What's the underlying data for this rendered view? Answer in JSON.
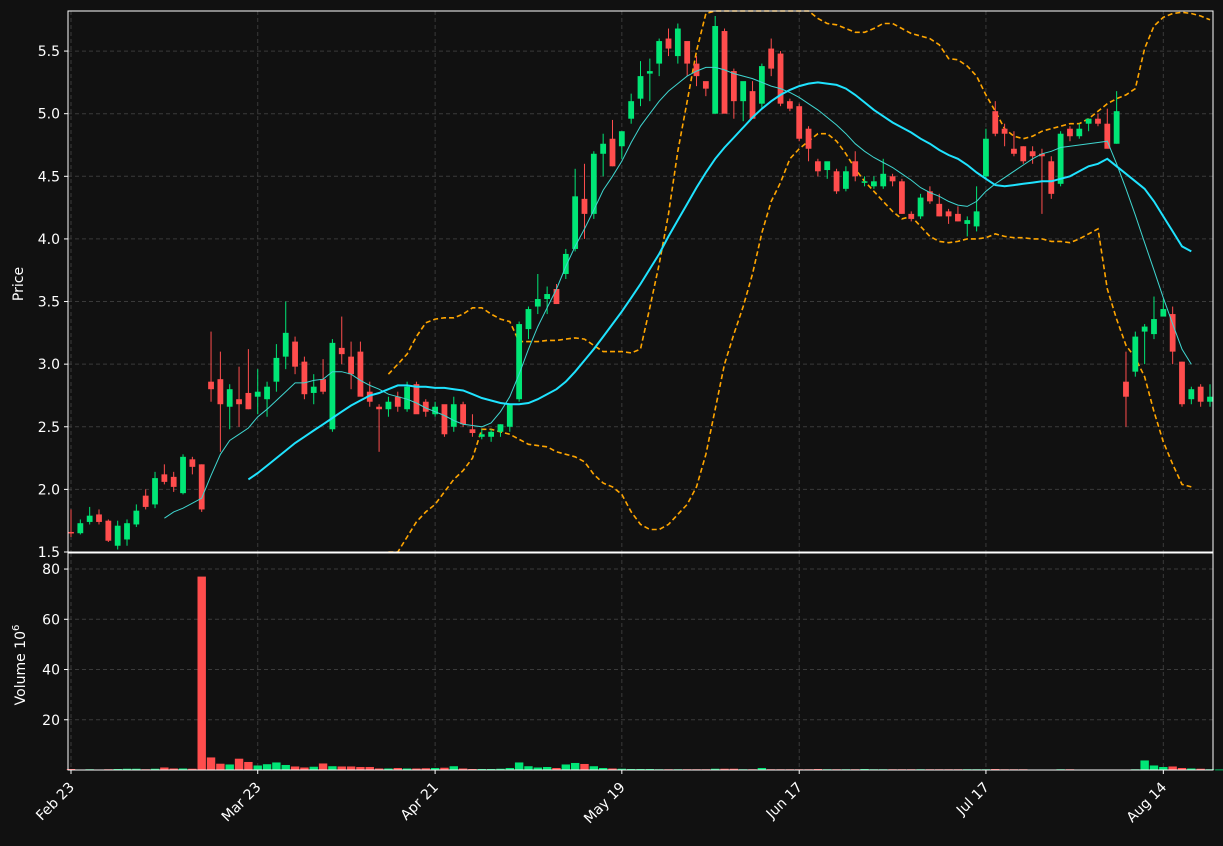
{
  "chart_data": [
    {
      "type": "candlestick",
      "panel": "price",
      "ylabel": "Price",
      "ylim": [
        1.5,
        5.82
      ],
      "y_ticks": [
        "1.5",
        "2.0",
        "2.5",
        "3.0",
        "3.5",
        "4.0",
        "4.5",
        "5.0",
        "5.5"
      ],
      "grid": true,
      "colors": {
        "up": "#00e676",
        "down": "#ff4d4d",
        "ma_fast": "#3fd6d0",
        "ma_slow": "#1fe3ff",
        "bands": "#ffa500",
        "background": "#111111"
      },
      "candles": [
        [
          1.66,
          1.84,
          1.62,
          1.65
        ],
        [
          1.65,
          1.76,
          1.64,
          1.73
        ],
        [
          1.74,
          1.86,
          1.72,
          1.79
        ],
        [
          1.8,
          1.84,
          1.72,
          1.74
        ],
        [
          1.75,
          1.76,
          1.58,
          1.59
        ],
        [
          1.55,
          1.75,
          1.52,
          1.71
        ],
        [
          1.6,
          1.76,
          1.55,
          1.73
        ],
        [
          1.72,
          1.88,
          1.7,
          1.83
        ],
        [
          1.95,
          2.0,
          1.84,
          1.86
        ],
        [
          1.88,
          2.14,
          1.85,
          2.09
        ],
        [
          2.12,
          2.2,
          2.04,
          2.06
        ],
        [
          2.1,
          2.14,
          1.98,
          2.02
        ],
        [
          1.97,
          2.28,
          1.96,
          2.26
        ],
        [
          2.24,
          2.26,
          2.12,
          2.18
        ],
        [
          2.2,
          2.2,
          1.82,
          1.84
        ],
        [
          2.86,
          3.26,
          2.7,
          2.8
        ],
        [
          2.88,
          3.1,
          2.3,
          2.68
        ],
        [
          2.66,
          2.84,
          2.48,
          2.8
        ],
        [
          2.72,
          2.98,
          2.5,
          2.68
        ],
        [
          2.77,
          3.12,
          2.64,
          2.64
        ],
        [
          2.74,
          2.96,
          2.6,
          2.78
        ],
        [
          2.72,
          2.86,
          2.58,
          2.82
        ],
        [
          2.86,
          3.16,
          2.78,
          3.05
        ],
        [
          3.06,
          3.5,
          2.96,
          3.25
        ],
        [
          3.18,
          3.22,
          2.92,
          2.98
        ],
        [
          3.02,
          3.06,
          2.72,
          2.76
        ],
        [
          2.77,
          2.92,
          2.68,
          2.82
        ],
        [
          2.88,
          3.04,
          2.76,
          2.78
        ],
        [
          2.48,
          3.2,
          2.46,
          3.17
        ],
        [
          3.13,
          3.38,
          3.0,
          3.08
        ],
        [
          3.06,
          3.18,
          2.8,
          2.92
        ],
        [
          3.1,
          3.18,
          2.76,
          2.74
        ],
        [
          2.78,
          2.86,
          2.66,
          2.7
        ],
        [
          2.66,
          2.68,
          2.3,
          2.64
        ],
        [
          2.64,
          2.74,
          2.58,
          2.7
        ],
        [
          2.74,
          2.78,
          2.62,
          2.66
        ],
        [
          2.64,
          2.86,
          2.62,
          2.82
        ],
        [
          2.84,
          2.86,
          2.66,
          2.6
        ],
        [
          2.7,
          2.72,
          2.58,
          2.62
        ],
        [
          2.6,
          2.7,
          2.58,
          2.66
        ],
        [
          2.68,
          2.64,
          2.42,
          2.44
        ],
        [
          2.5,
          2.74,
          2.46,
          2.68
        ],
        [
          2.68,
          2.7,
          2.5,
          2.52
        ],
        [
          2.48,
          2.6,
          2.42,
          2.45
        ],
        [
          2.42,
          2.48,
          2.4,
          2.44
        ],
        [
          2.42,
          2.48,
          2.38,
          2.46
        ],
        [
          2.46,
          2.52,
          2.42,
          2.52
        ],
        [
          2.5,
          2.68,
          2.46,
          2.68
        ],
        [
          2.72,
          3.34,
          2.7,
          3.32
        ],
        [
          3.28,
          3.46,
          3.2,
          3.44
        ],
        [
          3.46,
          3.72,
          3.4,
          3.52
        ],
        [
          3.52,
          3.62,
          3.4,
          3.56
        ],
        [
          3.6,
          3.64,
          3.48,
          3.48
        ],
        [
          3.72,
          3.92,
          3.68,
          3.88
        ],
        [
          3.92,
          4.56,
          3.9,
          4.34
        ],
        [
          4.32,
          4.6,
          4.0,
          4.2
        ],
        [
          4.2,
          4.7,
          4.16,
          4.68
        ],
        [
          4.68,
          4.84,
          4.5,
          4.76
        ],
        [
          4.8,
          4.95,
          4.58,
          4.58
        ],
        [
          4.74,
          4.86,
          4.64,
          4.86
        ],
        [
          4.96,
          5.16,
          4.92,
          5.1
        ],
        [
          5.12,
          5.42,
          5.06,
          5.3
        ],
        [
          5.32,
          5.44,
          5.1,
          5.34
        ],
        [
          5.4,
          5.6,
          5.3,
          5.58
        ],
        [
          5.6,
          5.68,
          5.46,
          5.52
        ],
        [
          5.46,
          5.72,
          5.4,
          5.68
        ],
        [
          5.58,
          5.52,
          5.3,
          5.4
        ],
        [
          5.4,
          5.46,
          5.22,
          5.3
        ],
        [
          5.26,
          5.24,
          5.14,
          5.2
        ],
        [
          5.0,
          5.78,
          5.0,
          5.7
        ],
        [
          5.66,
          5.68,
          5.02,
          5.0
        ],
        [
          5.34,
          5.36,
          4.96,
          5.1
        ],
        [
          5.1,
          5.2,
          4.94,
          5.26
        ],
        [
          5.18,
          5.26,
          4.96,
          4.96
        ],
        [
          5.08,
          5.4,
          5.04,
          5.38
        ],
        [
          5.52,
          5.6,
          5.3,
          5.36
        ],
        [
          5.48,
          5.5,
          5.06,
          5.08
        ],
        [
          5.1,
          5.12,
          5.02,
          5.04
        ],
        [
          5.06,
          5.08,
          4.78,
          4.8
        ],
        [
          4.88,
          4.9,
          4.62,
          4.72
        ],
        [
          4.62,
          4.64,
          4.5,
          4.54
        ],
        [
          4.55,
          4.6,
          4.48,
          4.62
        ],
        [
          4.54,
          4.56,
          4.36,
          4.38
        ],
        [
          4.4,
          4.58,
          4.38,
          4.54
        ],
        [
          4.62,
          4.7,
          4.46,
          4.5
        ],
        [
          4.46,
          4.5,
          4.42,
          4.46
        ],
        [
          4.42,
          4.5,
          4.4,
          4.46
        ],
        [
          4.42,
          4.64,
          4.4,
          4.52
        ],
        [
          4.5,
          4.52,
          4.42,
          4.46
        ],
        [
          4.46,
          4.48,
          4.2,
          4.2
        ],
        [
          4.2,
          4.22,
          4.14,
          4.16
        ],
        [
          4.18,
          4.36,
          4.16,
          4.33
        ],
        [
          4.38,
          4.42,
          4.28,
          4.3
        ],
        [
          4.28,
          4.36,
          4.18,
          4.18
        ],
        [
          4.22,
          4.24,
          4.12,
          4.18
        ],
        [
          4.2,
          4.26,
          4.14,
          4.14
        ],
        [
          4.12,
          4.18,
          4.02,
          4.15
        ],
        [
          4.1,
          4.42,
          4.06,
          4.22
        ],
        [
          4.5,
          4.88,
          4.48,
          4.8
        ],
        [
          5.02,
          5.1,
          4.82,
          4.84
        ],
        [
          4.88,
          4.92,
          4.74,
          4.84
        ],
        [
          4.72,
          4.86,
          4.66,
          4.68
        ],
        [
          4.74,
          4.74,
          4.6,
          4.62
        ],
        [
          4.7,
          4.74,
          4.6,
          4.66
        ],
        [
          4.68,
          4.72,
          4.2,
          4.66
        ],
        [
          4.62,
          4.66,
          4.32,
          4.36
        ],
        [
          4.44,
          4.86,
          4.42,
          4.84
        ],
        [
          4.88,
          4.9,
          4.78,
          4.82
        ],
        [
          4.82,
          4.92,
          4.8,
          4.88
        ],
        [
          4.92,
          4.96,
          4.86,
          4.96
        ],
        [
          4.96,
          5.0,
          4.9,
          4.92
        ],
        [
          4.92,
          5.04,
          4.9,
          4.72
        ],
        [
          4.76,
          5.18,
          4.76,
          5.02
        ],
        [
          2.86,
          3.1,
          2.5,
          2.74
        ],
        [
          2.94,
          3.26,
          2.9,
          3.22
        ],
        [
          3.26,
          3.32,
          3.0,
          3.3
        ],
        [
          3.24,
          3.54,
          3.2,
          3.36
        ],
        [
          3.38,
          3.52,
          3.4,
          3.44
        ],
        [
          3.4,
          3.46,
          3.0,
          3.1
        ],
        [
          3.02,
          3.02,
          2.66,
          2.68
        ],
        [
          2.72,
          2.82,
          2.68,
          2.8
        ],
        [
          2.82,
          2.84,
          2.66,
          2.7
        ],
        [
          2.7,
          2.84,
          2.66,
          2.74
        ]
      ],
      "ma_fast_start": 10,
      "ma_fast": [
        1.77,
        1.82,
        1.85,
        1.89,
        1.93,
        2.11,
        2.28,
        2.39,
        2.44,
        2.49,
        2.58,
        2.64,
        2.71,
        2.78,
        2.85,
        2.85,
        2.87,
        2.88,
        2.94,
        2.94,
        2.92,
        2.87,
        2.83,
        2.8,
        2.76,
        2.74,
        2.72,
        2.69,
        2.65,
        2.62,
        2.59,
        2.55,
        2.52,
        2.51,
        2.5,
        2.53,
        2.62,
        2.74,
        2.92,
        3.12,
        3.3,
        3.45,
        3.6,
        3.78,
        3.94,
        4.08,
        4.23,
        4.39,
        4.5,
        4.62,
        4.77,
        4.9,
        5.0,
        5.1,
        5.18,
        5.24,
        5.3,
        5.34,
        5.37,
        5.37,
        5.35,
        5.32,
        5.3,
        5.28,
        5.25,
        5.22,
        5.2,
        5.17,
        5.13,
        5.08,
        5.03,
        4.97,
        4.91,
        4.84,
        4.76,
        4.7,
        4.65,
        4.61,
        4.57,
        4.52,
        4.47,
        4.41,
        4.37,
        4.34,
        4.3,
        4.27,
        4.26,
        4.3,
        4.38,
        4.44,
        4.49,
        4.54,
        4.59,
        4.64,
        4.68,
        4.7,
        4.73,
        4.74,
        4.75,
        4.76,
        4.77,
        4.78,
        4.6,
        4.4,
        4.19,
        3.97,
        3.75,
        3.53,
        3.32,
        3.12,
        3.0
      ],
      "ma_slow_start": 19,
      "ma_slow": [
        2.08,
        2.13,
        2.19,
        2.25,
        2.31,
        2.37,
        2.42,
        2.47,
        2.52,
        2.57,
        2.62,
        2.67,
        2.71,
        2.75,
        2.77,
        2.8,
        2.83,
        2.83,
        2.82,
        2.82,
        2.81,
        2.81,
        2.8,
        2.79,
        2.76,
        2.73,
        2.71,
        2.69,
        2.68,
        2.68,
        2.69,
        2.72,
        2.76,
        2.8,
        2.86,
        2.94,
        3.03,
        3.12,
        3.22,
        3.32,
        3.42,
        3.53,
        3.64,
        3.76,
        3.88,
        4.02,
        4.15,
        4.28,
        4.41,
        4.53,
        4.64,
        4.73,
        4.81,
        4.89,
        4.97,
        5.04,
        5.1,
        5.15,
        5.19,
        5.22,
        5.24,
        5.25,
        5.24,
        5.23,
        5.2,
        5.15,
        5.09,
        5.03,
        4.98,
        4.93,
        4.89,
        4.85,
        4.8,
        4.76,
        4.71,
        4.67,
        4.64,
        4.59,
        4.53,
        4.48,
        4.43,
        4.42,
        4.43,
        4.44,
        4.45,
        4.46,
        4.46,
        4.48,
        4.5,
        4.54,
        4.58,
        4.6,
        4.64,
        4.58,
        4.52,
        4.46,
        4.4,
        4.3,
        4.18,
        4.06,
        3.94,
        3.9
      ],
      "upper_band": [
        2.92,
        3.0,
        3.08,
        3.22,
        3.33,
        3.36,
        3.37,
        3.37,
        3.4,
        3.45,
        3.45,
        3.4,
        3.36,
        3.34,
        3.18,
        3.18,
        3.18,
        3.19,
        3.19,
        3.2,
        3.21,
        3.2,
        3.15,
        3.1,
        3.1,
        3.1,
        3.09,
        3.12,
        3.45,
        3.8,
        4.2,
        4.7,
        5.1,
        5.5,
        5.8,
        5.82,
        5.82,
        5.82,
        5.82,
        5.82,
        5.82,
        5.82,
        5.82,
        5.82,
        5.82,
        5.82,
        5.76,
        5.72,
        5.71,
        5.68,
        5.65,
        5.65,
        5.68,
        5.72,
        5.72,
        5.68,
        5.64,
        5.62,
        5.6,
        5.55,
        5.44,
        5.43,
        5.38,
        5.3,
        5.15,
        5.02,
        4.88,
        4.82,
        4.8,
        4.82,
        4.86,
        4.88,
        4.9,
        4.92,
        4.92,
        4.96,
        5.02,
        5.08,
        5.12,
        5.15,
        5.2,
        5.52,
        5.7,
        5.77,
        5.8,
        5.81,
        5.8,
        5.78,
        5.75
      ],
      "lower_band": [
        1.48,
        1.5,
        1.62,
        1.74,
        1.82,
        1.88,
        1.98,
        2.08,
        2.15,
        2.25,
        2.48,
        2.48,
        2.46,
        2.44,
        2.4,
        2.36,
        2.35,
        2.34,
        2.3,
        2.28,
        2.26,
        2.22,
        2.12,
        2.05,
        2.02,
        1.96,
        1.82,
        1.72,
        1.68,
        1.68,
        1.72,
        1.8,
        1.88,
        2.02,
        2.28,
        2.64,
        3.0,
        3.24,
        3.46,
        3.72,
        4.05,
        4.3,
        4.45,
        4.64,
        4.72,
        4.78,
        4.84,
        4.84,
        4.78,
        4.68,
        4.56,
        4.46,
        4.38,
        4.3,
        4.22,
        4.16,
        4.18,
        4.1,
        4.02,
        3.98,
        3.97,
        3.98,
        4.0,
        4.0,
        4.01,
        4.04,
        4.02,
        4.01,
        4.01,
        4.0,
        4.0,
        3.98,
        3.98,
        3.97,
        4.0,
        4.04,
        4.08,
        3.6,
        3.36,
        3.15,
        3.05,
        2.9,
        2.62,
        2.38,
        2.2,
        2.04,
        2.02
      ]
    },
    {
      "type": "bar",
      "panel": "volume",
      "ylabel": "Volume  10",
      "ylabel_exponent": "6",
      "ylim": [
        0,
        84
      ],
      "y_ticks": [
        "20",
        "40",
        "60",
        "80"
      ],
      "grid": true,
      "x_tick_labels": [
        "Feb 23",
        "Mar 23",
        "Apr 21",
        "May 19",
        "Jun 17",
        "Jul 17",
        "Aug 14"
      ],
      "values": [
        0.4,
        0.2,
        0.3,
        0.2,
        0.3,
        0.4,
        0.5,
        0.5,
        0.3,
        0.5,
        1.0,
        0.6,
        0.6,
        0.5,
        77.0,
        5.0,
        2.5,
        2.2,
        4.5,
        3.2,
        1.8,
        2.3,
        3.0,
        2.0,
        1.4,
        1.0,
        1.3,
        2.6,
        1.5,
        1.4,
        1.4,
        1.2,
        1.2,
        0.6,
        0.6,
        0.8,
        0.6,
        0.6,
        0.7,
        0.8,
        0.9,
        1.5,
        0.6,
        0.4,
        0.4,
        0.4,
        0.5,
        0.8,
        3.0,
        1.5,
        1.0,
        1.2,
        0.8,
        2.2,
        2.8,
        2.4,
        1.5,
        0.8,
        0.6,
        0.5,
        0.4,
        0.4,
        0.4,
        0.3,
        0.3,
        0.3,
        0.3,
        0.3,
        0.3,
        0.5,
        0.5,
        0.5,
        0.3,
        0.3,
        0.8,
        0.3,
        0.3,
        0.3,
        0.3,
        0.3,
        0.4,
        0.3,
        0.3,
        0.3,
        0.3,
        0.4,
        0.3,
        0.3,
        0.3,
        0.3,
        0.3,
        0.3,
        0.3,
        0.3,
        0.3,
        0.3,
        0.3,
        0.3,
        0.3,
        0.4,
        0.3,
        0.3,
        0.3,
        0.2,
        0.2,
        0.2,
        0.3,
        0.3,
        0.2,
        0.2,
        0.2,
        0.2,
        0.2,
        0.2,
        0.3,
        3.8,
        1.8,
        1.2,
        1.4,
        0.8,
        0.6,
        0.5,
        0.3,
        0.2
      ]
    }
  ]
}
